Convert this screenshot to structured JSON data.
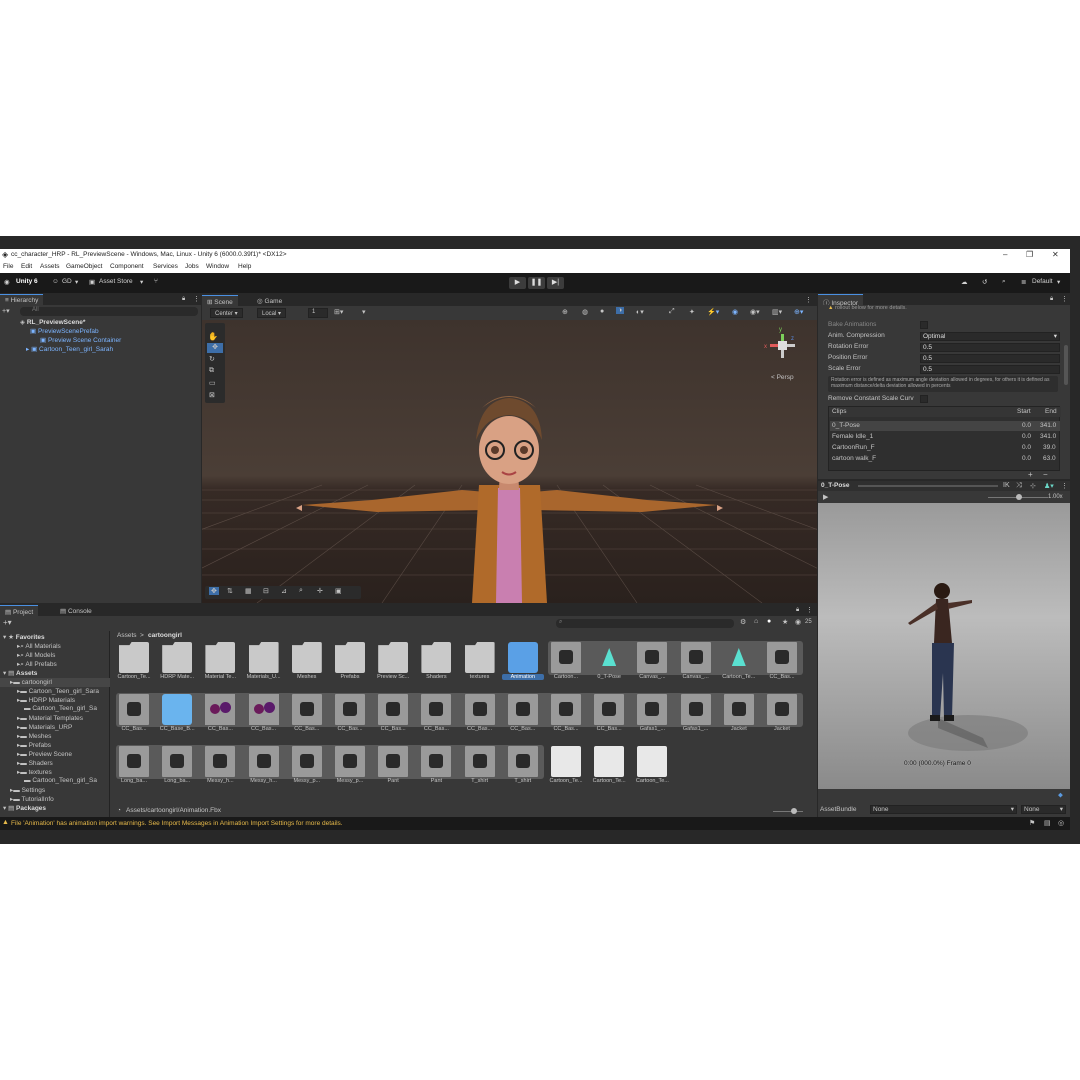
{
  "window": {
    "title": "cc_character_HRP - RL_PreviewScene - Windows, Mac, Linux - Unity 6 (6000.0.39f1)* <DX12>",
    "minimize": "–",
    "maximize": "❐",
    "close": "✕"
  },
  "menu": [
    "File",
    "Edit",
    "Assets",
    "GameObject",
    "Component",
    "Services",
    "Jobs",
    "Window",
    "Help"
  ],
  "toolbar": {
    "account": "Unity 6",
    "user": "GD",
    "asset_store": "Asset Store",
    "layout": "Default",
    "play": "▶",
    "pause": "❚❚",
    "step": "▶|"
  },
  "hierarchy": {
    "tab": "Hierarchy",
    "search_placeholder": "All",
    "rows": [
      "RL_PreviewScene*",
      "PreviewScenePrefab",
      "Preview Scene Container",
      "Cartoon_Teen_girl_Sarah"
    ]
  },
  "scene": {
    "tabs": [
      "Scene",
      "Game"
    ],
    "pivot": "Center",
    "space": "Local",
    "grid_value": "1",
    "persp": "< Persp",
    "gizmo_axes": [
      "x",
      "y",
      "z"
    ]
  },
  "inspector": {
    "tab": "Inspector",
    "top_text": "rollout below for more details.",
    "bake_animations": "Bake Animations",
    "fields": [
      {
        "label": "Anim. Compression",
        "value": "Optimal"
      },
      {
        "label": "Rotation Error",
        "value": "0.5"
      },
      {
        "label": "Position Error",
        "value": "0.5"
      },
      {
        "label": "Scale Error",
        "value": "0.5"
      }
    ],
    "note": "Rotation error is defined as maximum angle deviation allowed in degrees, for others it is defined as maximum distance/delta deviation allowed in percents",
    "remove_constant": "Remove Constant Scale Curv",
    "clips_header": {
      "name": "Clips",
      "start": "Start",
      "end": "End"
    },
    "clips": [
      {
        "name": "0_T-Pose",
        "start": "0.0",
        "end": "341.0"
      },
      {
        "name": "Female Idle_1",
        "start": "0.0",
        "end": "341.0"
      },
      {
        "name": "CartoonRun_F",
        "start": "0.0",
        "end": "39.0"
      },
      {
        "name": "cartoon walk_F",
        "start": "0.0",
        "end": "63.0"
      }
    ],
    "add": "+",
    "remove": "−"
  },
  "preview": {
    "clip": "0_T-Pose",
    "speed": "1.00x",
    "time": "0:00 (000.0%) Frame 0",
    "asset_bundle_label": "AssetBundle",
    "asset_bundle": "None",
    "variant": "None"
  },
  "project": {
    "tabs": [
      "Project",
      "Console"
    ],
    "count": "25",
    "breadcrumb": [
      "Assets",
      "cartoongirl"
    ],
    "tree": [
      {
        "label": "Favorites",
        "indent": 0,
        "bold": true
      },
      {
        "label": "All Materials",
        "indent": 2
      },
      {
        "label": "All Models",
        "indent": 2
      },
      {
        "label": "All Prefabs",
        "indent": 2
      },
      {
        "label": "Assets",
        "indent": 0,
        "bold": true
      },
      {
        "label": "cartoongirl",
        "indent": 1
      },
      {
        "label": "Cartoon_Teen_girl_Sara",
        "indent": 2
      },
      {
        "label": "HDRP Materials",
        "indent": 2
      },
      {
        "label": "Cartoon_Teen_girl_Sa",
        "indent": 3
      },
      {
        "label": "Material Templates",
        "indent": 2
      },
      {
        "label": "Materials_URP",
        "indent": 2
      },
      {
        "label": "Meshes",
        "indent": 2
      },
      {
        "label": "Prefabs",
        "indent": 2
      },
      {
        "label": "Preview Scene",
        "indent": 2
      },
      {
        "label": "Shaders",
        "indent": 2
      },
      {
        "label": "textures",
        "indent": 2
      },
      {
        "label": "Cartoon_Teen_girl_Sa",
        "indent": 3
      },
      {
        "label": "Settings",
        "indent": 1
      },
      {
        "label": "TutorialInfo",
        "indent": 1
      },
      {
        "label": "Packages",
        "indent": 0,
        "bold": true
      }
    ],
    "row1": [
      "Cartoon_Te...",
      "HDRP Mate...",
      "Material Te...",
      "Materials_U...",
      "Meshes",
      "Prefabs",
      "Preview Sc...",
      "Shaders",
      "textures",
      "Animation",
      "Cartoon...",
      "0_T-Pose",
      "Canvas_...",
      "Canvas_...",
      "Cartoon_Te...",
      "CC_Bas..."
    ],
    "row2": [
      "CC_Bas...",
      "CC_Base_B...",
      "CC_Bas...",
      "CC_Bas...",
      "CC_Bas...",
      "CC_Bas...",
      "CC_Bas...",
      "CC_Bas...",
      "CC_Bas...",
      "CC_Bas...",
      "CC_Bas...",
      "CC_Bas...",
      "Gafas1_...",
      "Gafas1_...",
      "Jacket",
      "Jacket"
    ],
    "row3": [
      "Long_ba...",
      "Long_ba...",
      "Messy_h...",
      "Messy_h...",
      "Messy_p...",
      "Messy_p...",
      "Pant",
      "Pant",
      "T_shirt",
      "T_shirt",
      "Cartoon_Te...",
      "Cartoon_Te...",
      "Cartoon_Te..."
    ],
    "path": "Assets/cartoongirl/Animation.Fbx"
  },
  "status": {
    "message": "File 'Animation' has animation import warnings. See Import Messages in Animation Import Settings for more details.",
    "color": "#e6b94a"
  }
}
